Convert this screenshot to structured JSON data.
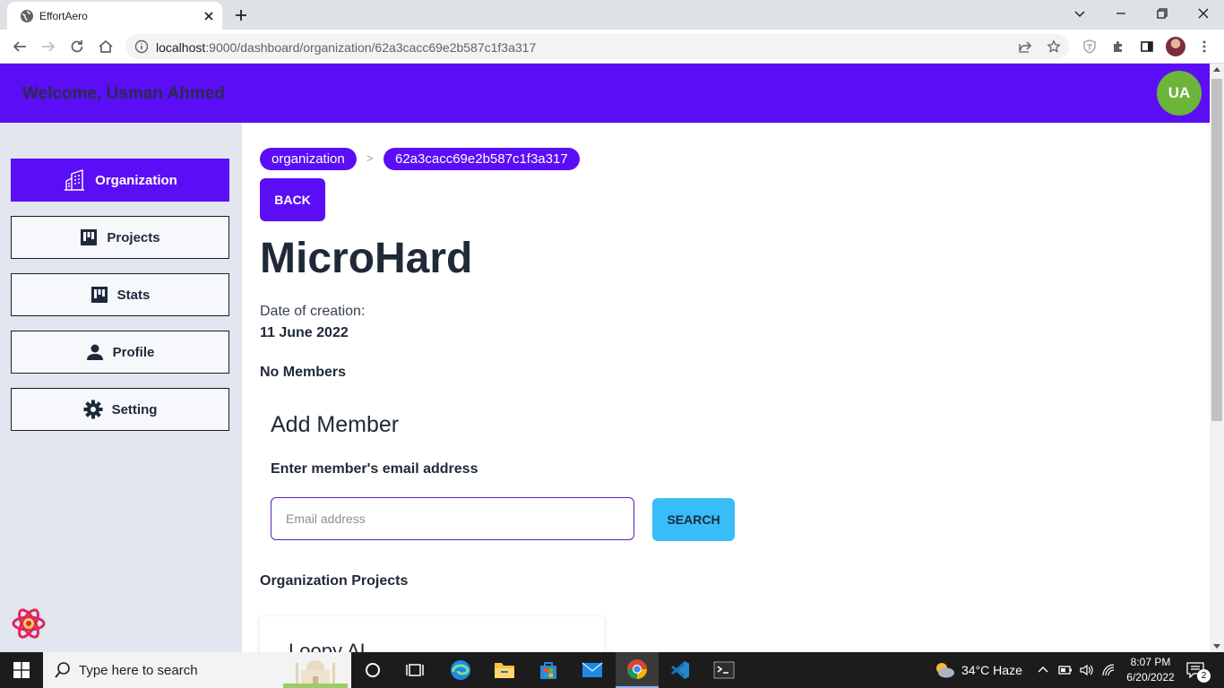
{
  "browser": {
    "tab_title": "EffortAero",
    "url_host": "localhost",
    "url_rest": ":9000/dashboard/organization/62a3cacc69e2b587c1f3a317"
  },
  "header": {
    "welcome": "Welcome, Usman Ahmed",
    "avatar_initials": "UA",
    "brand_color": "#5b0ef5"
  },
  "sidebar": {
    "items": [
      {
        "label": "Organization",
        "icon": "building-icon",
        "active": true
      },
      {
        "label": "Projects",
        "icon": "board-icon",
        "active": false
      },
      {
        "label": "Stats",
        "icon": "board-icon",
        "active": false
      },
      {
        "label": "Profile",
        "icon": "person-icon",
        "active": false
      },
      {
        "label": "Setting",
        "icon": "gear-icon",
        "active": false
      }
    ]
  },
  "main": {
    "breadcrumb": [
      "organization",
      "62a3cacc69e2b587c1f3a317"
    ],
    "back_label": "BACK",
    "org_name": "MicroHard",
    "date_label": "Date of creation:",
    "date_value": "11 June 2022",
    "members_status": "No Members",
    "add_member_title": "Add Member",
    "email_label": "Enter member's email address",
    "email_placeholder": "Email address",
    "email_value": "",
    "search_label": "SEARCH",
    "projects_heading": "Organization Projects",
    "projects": [
      {
        "name": "Loopy AI"
      }
    ]
  },
  "taskbar": {
    "search_placeholder": "Type here to search",
    "weather": "34°C  Haze",
    "time": "8:07 PM",
    "date": "6/20/2022",
    "notifications": "2"
  }
}
